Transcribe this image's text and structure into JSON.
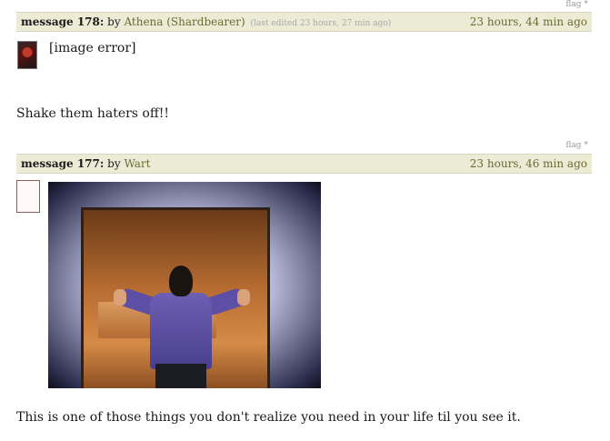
{
  "messages": [
    {
      "flag_label": "flag",
      "flag_star": "*",
      "number_label": "message 178:",
      "by_label": "by",
      "author": "Athena (Shardbearer)",
      "edited_note": "(last edited 23 hours, 27 min ago)",
      "timestamp": "23 hours, 44 min ago",
      "image_error": "[image error]",
      "text": "Shake them haters off!!"
    },
    {
      "flag_label": "flag",
      "flag_star": "*",
      "number_label": "message 177:",
      "by_label": "by",
      "author": "Wart",
      "timestamp": "23 hours, 46 min ago",
      "text": "This is one of those things you don't realize you need in your life til you see it."
    }
  ],
  "colors": {
    "header_bg": "#ecebd6",
    "author_link": "#6d6a36",
    "edited_note": "#a8a8a8",
    "flag": "#9a9a9a"
  },
  "icons": {
    "avatar_athena": "avatar-image",
    "avatar_wart": "avatar-placeholder",
    "gif": "animated-gif-image"
  }
}
